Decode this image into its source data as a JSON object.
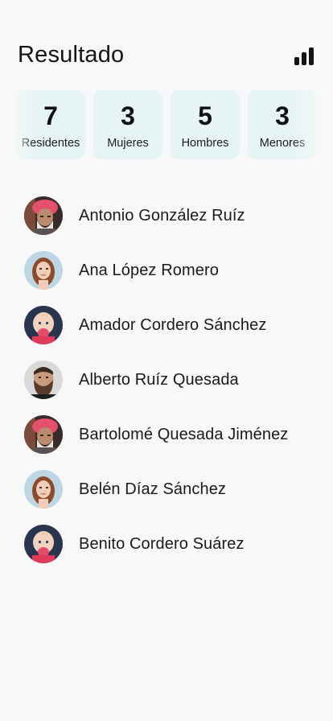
{
  "header": {
    "title": "Resultado",
    "chart_icon": "bar-chart-icon"
  },
  "stats": [
    {
      "value": "7",
      "label": "Residentes"
    },
    {
      "value": "3",
      "label": "Mujeres"
    },
    {
      "value": "5",
      "label": "Hombres"
    },
    {
      "value": "3",
      "label": "Menores"
    }
  ],
  "residents": [
    {
      "name": "Antonio González Ruíz",
      "avatar": "elderly-man-turban"
    },
    {
      "name": "Ana López Romero",
      "avatar": "young-woman-redhead"
    },
    {
      "name": "Amador Cordero Sánchez",
      "avatar": "baby"
    },
    {
      "name": "Alberto Ruíz Quesada",
      "avatar": "bearded-man"
    },
    {
      "name": "Bartolomé Quesada Jiménez",
      "avatar": "elderly-man-turban"
    },
    {
      "name": "Belén Díaz Sánchez",
      "avatar": "young-woman-redhead"
    },
    {
      "name": "Benito Cordero Suárez",
      "avatar": "baby"
    }
  ]
}
